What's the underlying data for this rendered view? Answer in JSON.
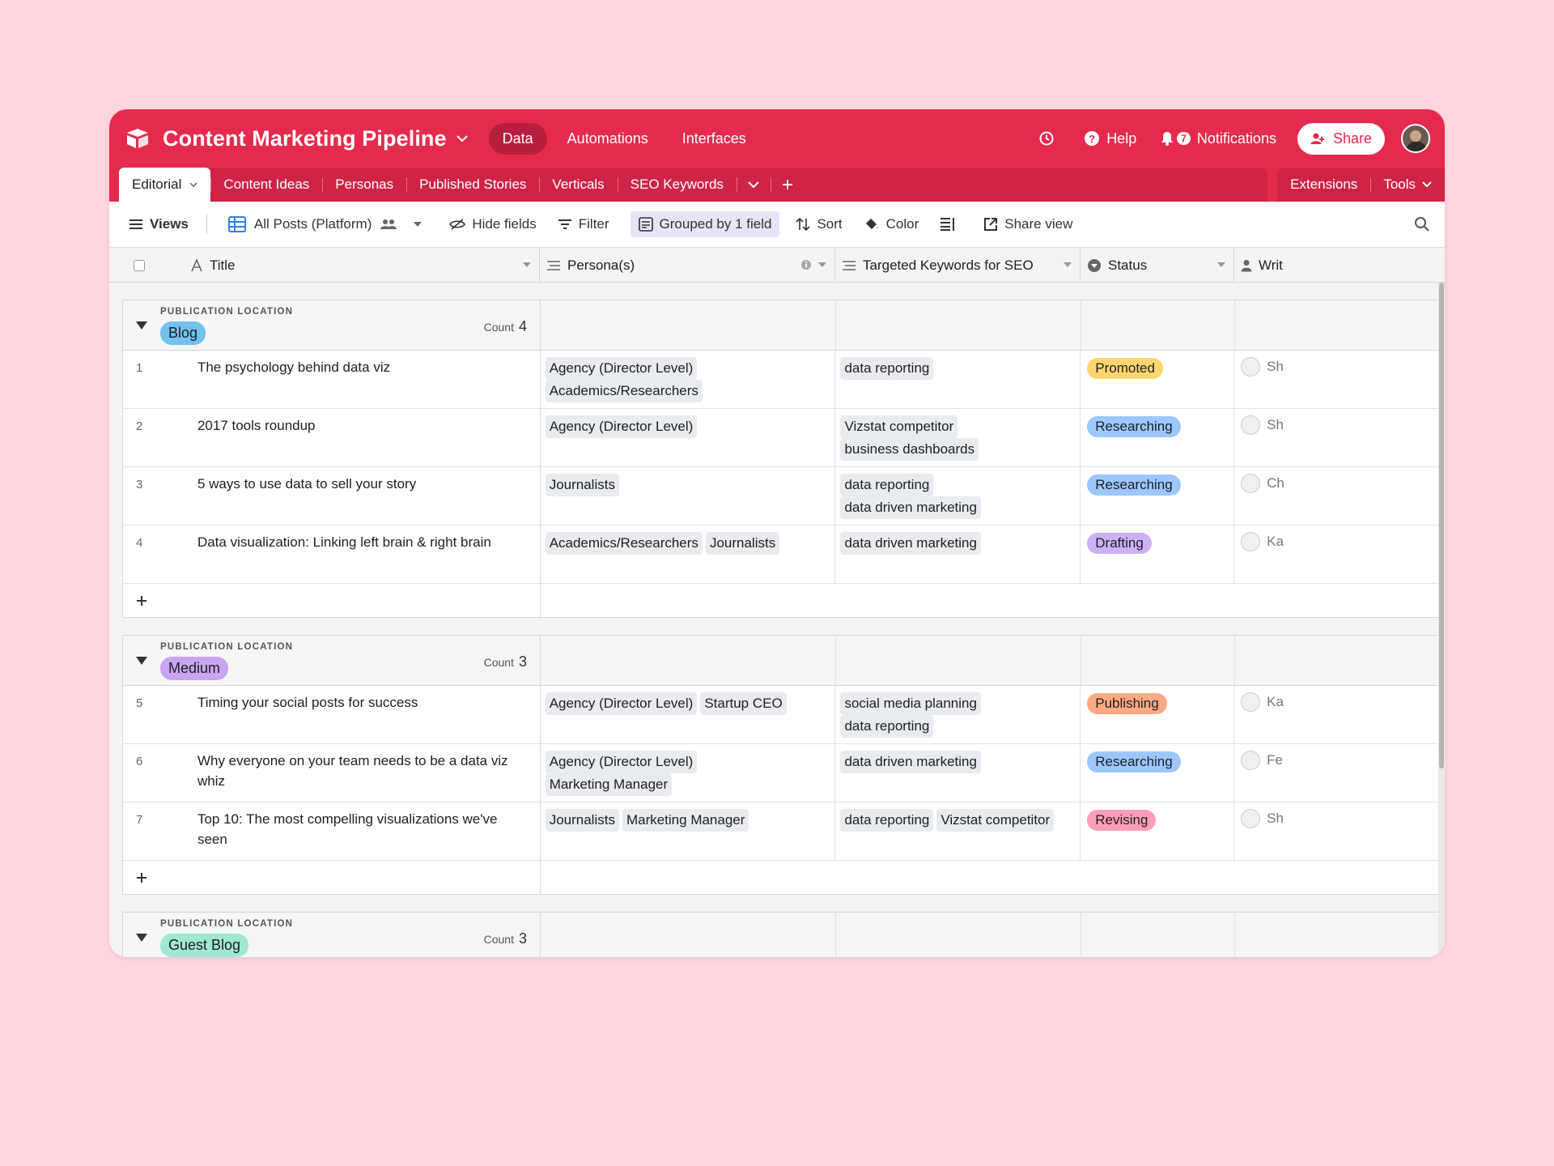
{
  "app": {
    "title": "Content Marketing Pipeline"
  },
  "nav": {
    "data": "Data",
    "automations": "Automations",
    "interfaces": "Interfaces"
  },
  "topright": {
    "help": "Help",
    "notifications": "Notifications",
    "notif_count": "7",
    "share": "Share"
  },
  "tabs": [
    "Editorial",
    "Content Ideas",
    "Personas",
    "Published Stories",
    "Verticals",
    "SEO Keywords"
  ],
  "tabs_right": {
    "extensions": "Extensions",
    "tools": "Tools"
  },
  "toolbar": {
    "views": "Views",
    "view_name": "All Posts (Platform)",
    "hide_fields": "Hide fields",
    "filter": "Filter",
    "grouped": "Grouped by 1 field",
    "sort": "Sort",
    "color": "Color",
    "share_view": "Share view"
  },
  "columns": {
    "title": "Title",
    "personas": "Persona(s)",
    "keywords": "Targeted Keywords for SEO",
    "status": "Status",
    "writer": "Writ"
  },
  "colors": {
    "brand": "#e52b4d",
    "blog": "#73c2ee",
    "medium": "#c9a6f2",
    "guest_blog": "#9ee8d4",
    "promoted": "#ffd66e",
    "researching": "#9cc7ff",
    "drafting": "#cdb0f5",
    "publishing": "#ffa981",
    "revising": "#ff9eb7"
  },
  "group_label": "PUBLICATION LOCATION",
  "count_label": "Count",
  "groups": [
    {
      "name": "Blog",
      "count": "4",
      "rows": [
        {
          "num": "1",
          "title": "The psychology behind data viz",
          "personas": [
            "Agency (Director Level)",
            "Academics/Researchers"
          ],
          "keywords": [
            "data reporting"
          ],
          "status": "Promoted",
          "writer": "Sh"
        },
        {
          "num": "2",
          "title": "2017 tools roundup",
          "personas": [
            "Agency (Director Level)"
          ],
          "keywords": [
            "Vizstat competitor",
            "business dashboards"
          ],
          "status": "Researching",
          "writer": "Sh"
        },
        {
          "num": "3",
          "title": "5 ways to use data to sell your story",
          "personas": [
            "Journalists"
          ],
          "keywords": [
            "data reporting",
            "data driven marketing"
          ],
          "status": "Researching",
          "writer": "Ch"
        },
        {
          "num": "4",
          "title": "Data visualization: Linking left brain & right brain",
          "personas": [
            "Academics/Researchers",
            "Journalists"
          ],
          "keywords": [
            "data driven marketing"
          ],
          "status": "Drafting",
          "writer": "Ka"
        }
      ]
    },
    {
      "name": "Medium",
      "count": "3",
      "rows": [
        {
          "num": "5",
          "title": "Timing your social posts for success",
          "personas": [
            "Agency (Director Level)",
            "Startup CEO"
          ],
          "keywords": [
            "social media planning",
            "data reporting"
          ],
          "status": "Publishing",
          "writer": "Ka"
        },
        {
          "num": "6",
          "title": "Why everyone on your team needs to be a data viz whiz",
          "personas": [
            "Agency (Director Level)",
            "Marketing Manager"
          ],
          "keywords": [
            "data driven marketing"
          ],
          "status": "Researching",
          "writer": "Fe"
        },
        {
          "num": "7",
          "title": "Top 10: The most compelling visualizations we've seen",
          "personas": [
            "Journalists",
            "Marketing Manager"
          ],
          "keywords": [
            "data reporting",
            "Vizstat competitor"
          ],
          "status": "Revising",
          "writer": "Sh"
        }
      ]
    },
    {
      "name": "Guest Blog",
      "count": "3",
      "rows": []
    }
  ]
}
